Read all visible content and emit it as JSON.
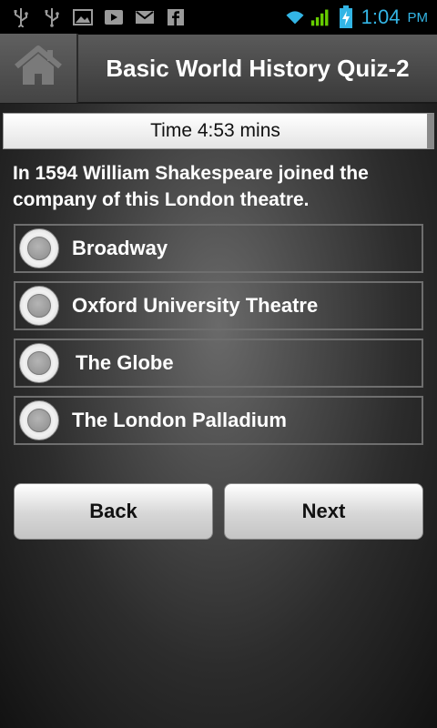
{
  "status_bar": {
    "time": "1:04",
    "ampm": "PM",
    "left_icons": [
      "usb-icon",
      "usb-icon",
      "image-icon",
      "play-icon",
      "gmail-icon",
      "facebook-icon"
    ],
    "right_icons": [
      "wifi-icon",
      "signal-icon",
      "battery-icon"
    ],
    "accent_color": "#33b5e5"
  },
  "header": {
    "home_icon": "home-icon",
    "title": "Basic World History Quiz-2"
  },
  "timer": {
    "text": "Time 4:53 mins"
  },
  "question": {
    "text": "In 1594 William Shakespeare joined the company of this London theatre."
  },
  "options": [
    {
      "label": "Broadway",
      "selected": false
    },
    {
      "label": "Oxford University Theatre",
      "selected": false
    },
    {
      "label": "The Globe",
      "selected": false
    },
    {
      "label": "The London Palladium",
      "selected": false
    }
  ],
  "buttons": {
    "back": "Back",
    "next": "Next"
  }
}
